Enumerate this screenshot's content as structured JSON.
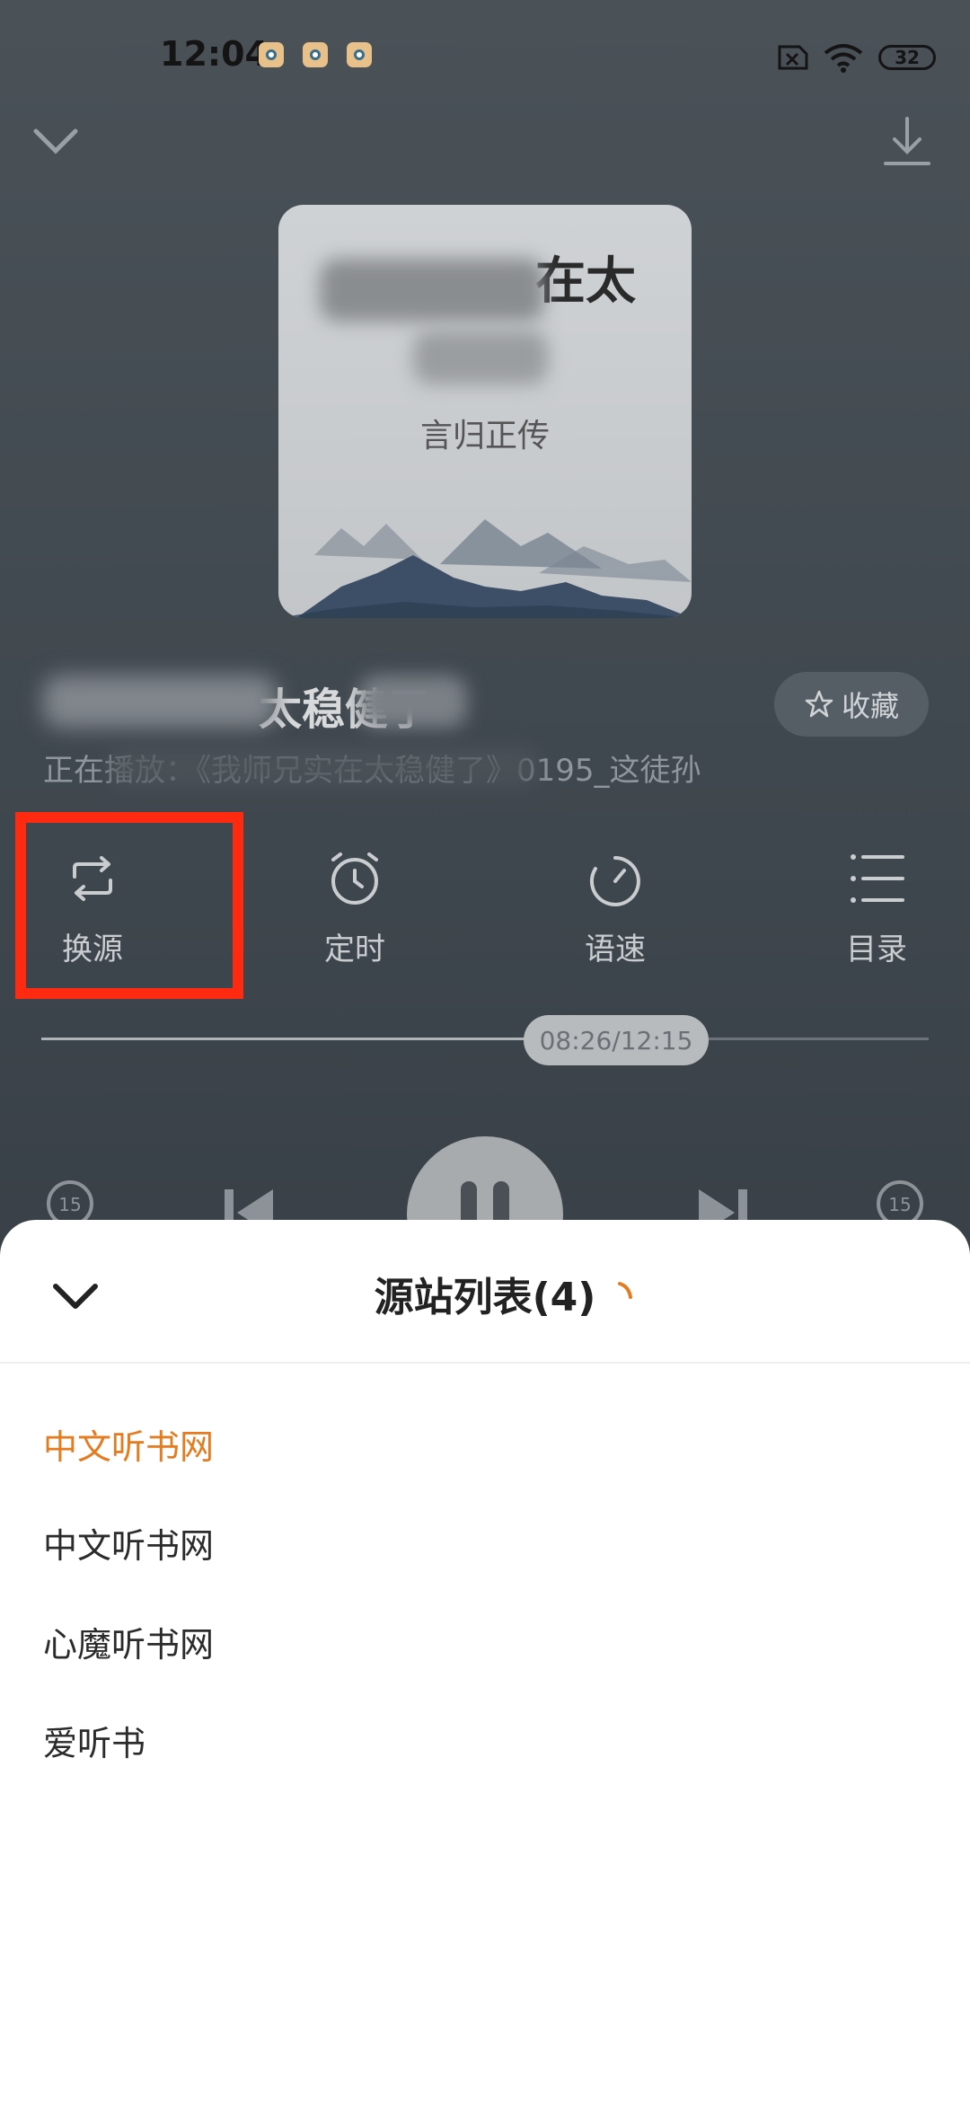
{
  "status_bar": {
    "time": "12:04",
    "battery": "32"
  },
  "cover": {
    "title_visible": "在太",
    "author": "言归正传"
  },
  "track": {
    "title_visible": "太稳健了",
    "subtitle_visible": "正在播放：《我师兄实在太稳健了》0195_这徒孙"
  },
  "favorite": {
    "label": "收藏"
  },
  "controls": {
    "switch_source": "换源",
    "timer": "定时",
    "speed": "语速",
    "catalog": "目录"
  },
  "progress": {
    "time_text": "08:26/12:15",
    "fraction": 0.688
  },
  "skip": {
    "back_seconds": "15",
    "forward_seconds": "15"
  },
  "sheet": {
    "title": "源站列表(4)",
    "sources": [
      "中文听书网",
      "中文听书网",
      "心魔听书网",
      "爱听书"
    ],
    "selected_index": 0
  },
  "colors": {
    "accent": "#e57a1e",
    "highlight": "#ff2a0f"
  }
}
